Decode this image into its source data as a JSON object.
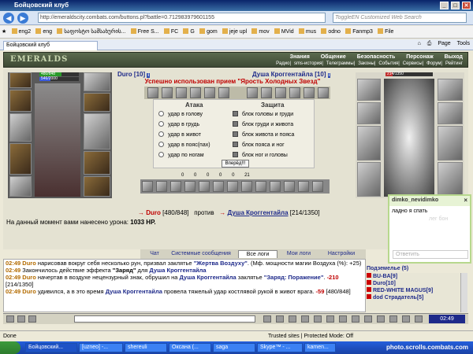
{
  "window": {
    "title": "Бойцовский клуб"
  },
  "browser": {
    "url": "http://emeraldscity.combats.com/buttons.pl?battle=0.712983979601155",
    "search_placeholder": "ToggleEN Customized Web Search",
    "favorites": [
      "eng2",
      "eng",
      "საფოსტო სამსახურის...",
      "Free S...",
      "FC",
      "G",
      "gom",
      "jeje upl",
      "mov",
      "MVid",
      "mus",
      "odno",
      "Fanmp3",
      "File"
    ],
    "tab_title": "Бойцовский клуб",
    "commands": [
      "Page",
      "Tools"
    ]
  },
  "game": {
    "logo": "EMERALDS",
    "menu": [
      "Знания",
      "Общение",
      "Безопасность",
      "Персонаж",
      "Выход"
    ],
    "submenu": [
      "Радио",
      "sms-история",
      "Телеграммы",
      "Законы",
      "События",
      "Сервисы",
      "Форум",
      "Рейтинг"
    ],
    "left_player": {
      "name": "Duro",
      "level": "10",
      "hp_text": "480/848",
      "mp_text": "546/2000",
      "hp_fraction": 0.566,
      "mp_fraction": 0.273
    },
    "right_player": {
      "name": "Душа Кроггентайла",
      "level": "10",
      "hp_text": "214/1350",
      "hp_fraction": 0.158
    },
    "status_message": "Успешно использован прием \"Ярость Холодных Звезд\"",
    "attack_header": "Атака",
    "defense_header": "Защита",
    "attack_options": [
      "удар в голову",
      "удар в грудь",
      "удар в живот",
      "удар в пояс(пах)",
      "удар по ногам"
    ],
    "defense_options": [
      "блок головы и груди",
      "блок груди и живота",
      "блок живота и пояса",
      "блок пояса и ног",
      "блок ног и головы"
    ],
    "forward_button": "Вперёд!!!",
    "counters": [
      "0",
      "0",
      "0",
      "0",
      "0",
      "21"
    ],
    "versus": {
      "left": "Duro",
      "left_hp": "[480/848]",
      "word": "против",
      "right": "Душа Кроггентайла",
      "right_hp": "[214/1350]"
    },
    "damage_line": "На данный момент вами нанесено урона:",
    "damage_value": "1033 HP."
  },
  "log_tabs": [
    "Чат",
    "Системные сообщения",
    "Все логи",
    "Мои логи",
    "Настройки"
  ],
  "log_lines": [
    {
      "time": "02:49",
      "text_parts": [
        {
          "c": "nr",
          "t": "Duro"
        },
        {
          "c": "",
          "t": " нарисовав вокруг себя несколько рун, призвал заклятье "
        },
        {
          "c": "q",
          "t": "\"Жертва Воздуху\""
        },
        {
          "c": "",
          "t": ". (Мф. мощности магии Воздуха (%): +25)"
        }
      ]
    },
    {
      "time": "02:49",
      "text_parts": [
        {
          "c": "",
          "t": "Закончилось действие эффекта "
        },
        {
          "c": "b",
          "t": "\"Заряд\""
        },
        {
          "c": "",
          "t": " для "
        },
        {
          "c": "nm",
          "t": "Душа Кроггентайла"
        }
      ]
    },
    {
      "time": "02:49",
      "text_parts": [
        {
          "c": "nr",
          "t": "Duro"
        },
        {
          "c": "",
          "t": " начертав в воздухе нецензурный знак, обрушил на "
        },
        {
          "c": "nm",
          "t": "Душа Кроггентайла"
        },
        {
          "c": "",
          "t": " заклятье "
        },
        {
          "c": "q",
          "t": "\"Заряд: Поражение\""
        },
        {
          "c": "",
          "t": ". "
        },
        {
          "c": "dmgv",
          "t": "-210"
        },
        {
          "c": "",
          "t": " [214/1350]"
        }
      ]
    },
    {
      "time": "02:49",
      "text_parts": [
        {
          "c": "nr",
          "t": "Duro"
        },
        {
          "c": "",
          "t": " удивился, а в это время "
        },
        {
          "c": "nm",
          "t": "Душа Кроггентайла"
        },
        {
          "c": "",
          "t": " провела тяжелый удар костлявой рукой в живот врага. "
        },
        {
          "c": "dmgv",
          "t": "-59"
        },
        {
          "c": "",
          "t": " [480/848]"
        }
      ]
    }
  ],
  "location": {
    "title": "Подземелье (5)",
    "players": [
      "BU-BA[9]",
      "Duro[10]",
      "RED-WHITE MAGUS[9]",
      "dod Страдатель[5]"
    ]
  },
  "clock": "02:49",
  "popup": {
    "title": "dimko_nevidimko",
    "message": "ладно я спать",
    "ghost_text": "лег бон",
    "reply_placeholder": "Ответить"
  },
  "statusbar": {
    "left": "Done",
    "zone": "Trusted sites | Protected Mode: Off"
  },
  "taskbar": {
    "items": [
      "Бойцовский...",
      "[uzneo] -...",
      "shereuli",
      "Оксана (...",
      "saga",
      "Skype™ - ...",
      "kamen..."
    ],
    "watermark": "photo.scrolls.combats.com"
  },
  "colors": {
    "status_red": "#c00000",
    "player_blue": "#1e2a8a",
    "name_orange": "#b36b00",
    "header_green": "#3e4935",
    "popup_border": "#b7d88d"
  }
}
